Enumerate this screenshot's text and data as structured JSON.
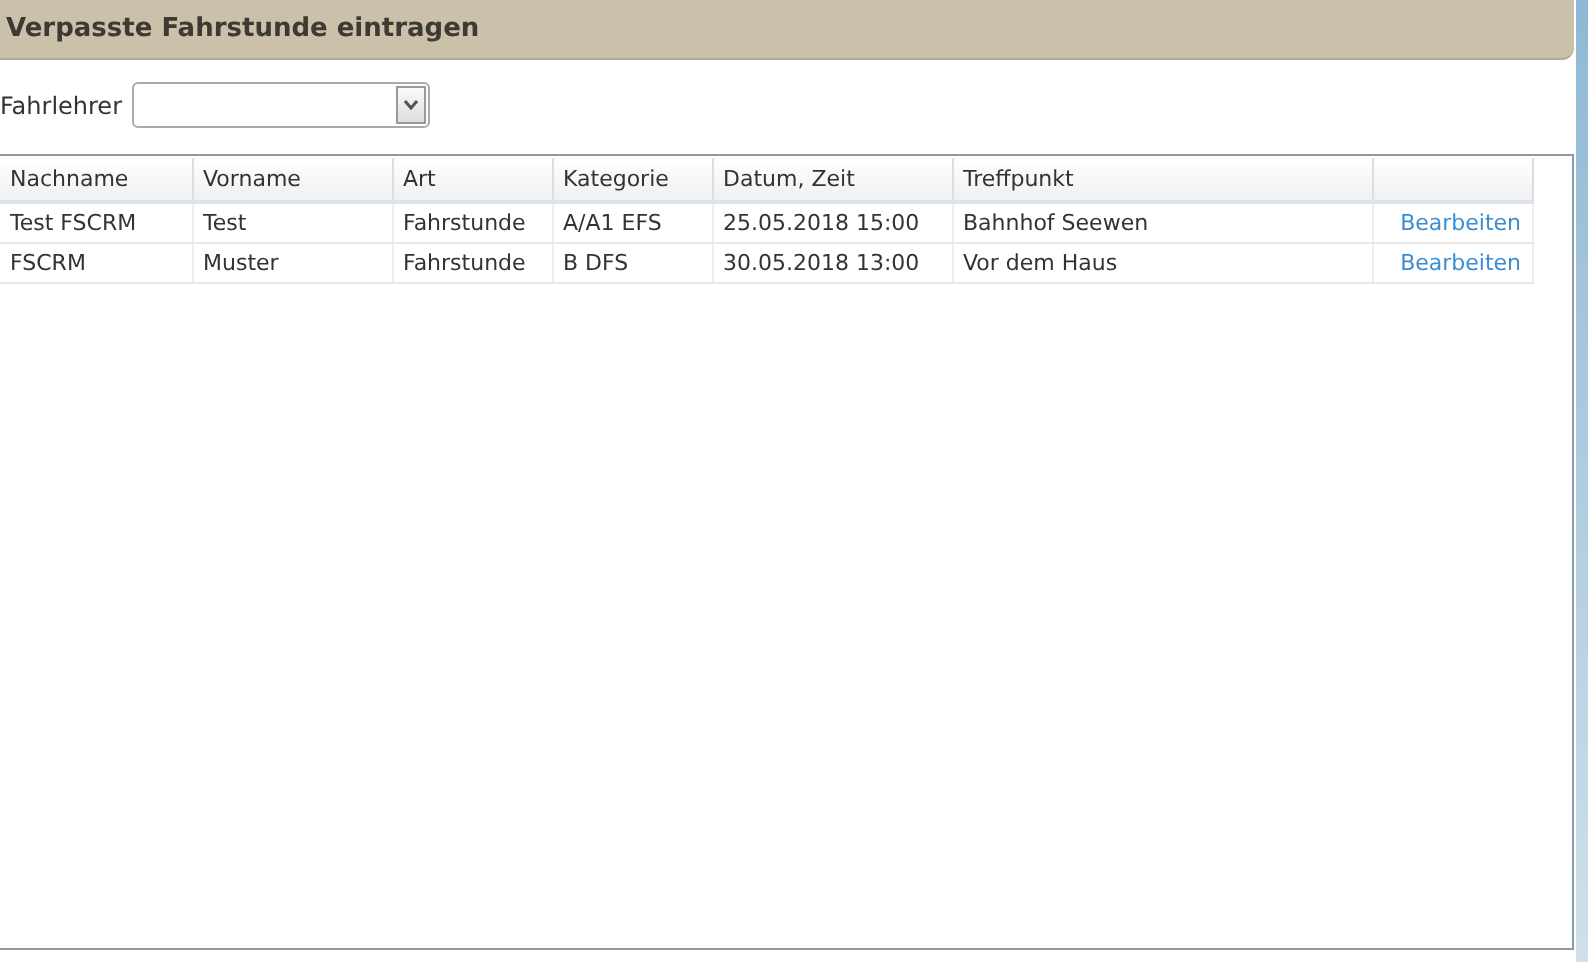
{
  "title": "Verpasste Fahrstunde eintragen",
  "filter": {
    "label": "Fahrlehrer"
  },
  "table": {
    "columns": [
      "Nachname",
      "Vorname",
      "Art",
      "Kategorie",
      "Datum, Zeit",
      "Treffpunkt"
    ],
    "rows": [
      {
        "cells": [
          "Test FSCRM",
          "Test",
          "Fahrstunde",
          "A/A1 EFS",
          "25.05.2018 15:00",
          "Bahnhof Seewen"
        ],
        "action": "Bearbeiten"
      },
      {
        "cells": [
          "FSCRM",
          "Muster",
          "Fahrstunde",
          "B DFS",
          "30.05.2018 13:00",
          "Vor dem Haus"
        ],
        "action": "Bearbeiten"
      }
    ]
  }
}
